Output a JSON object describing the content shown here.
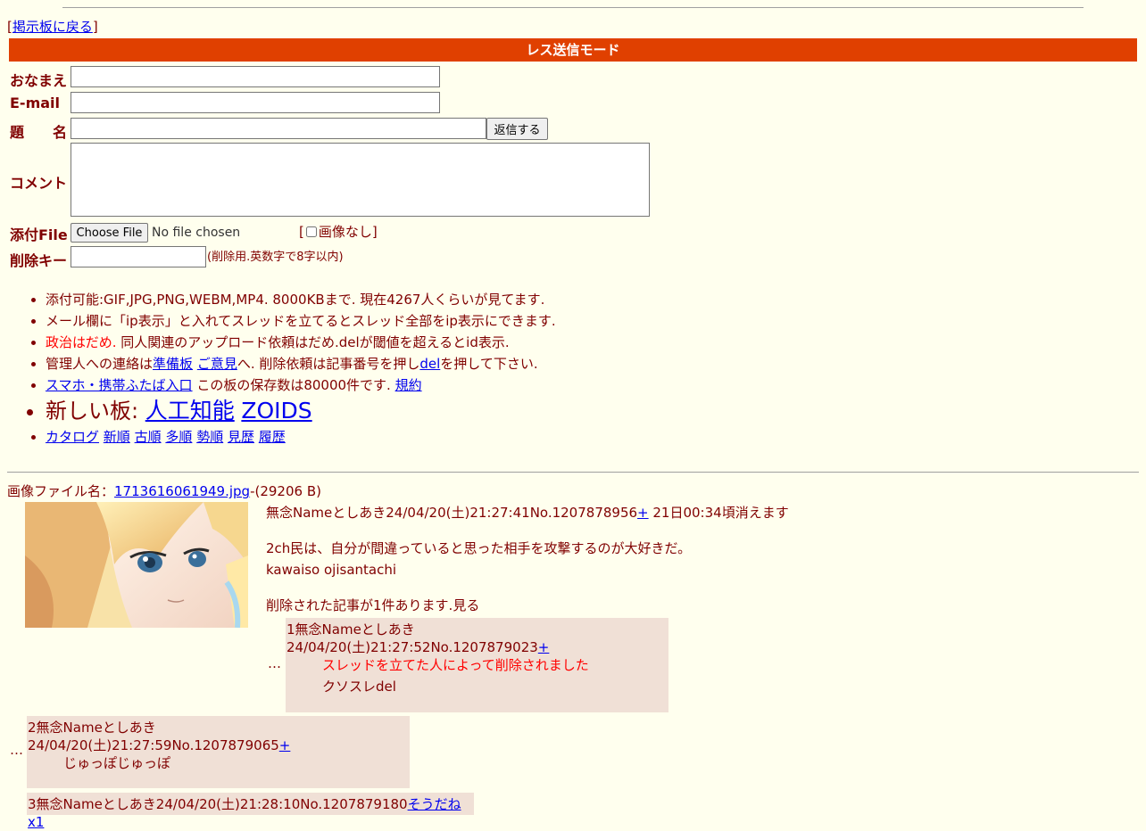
{
  "nav": {
    "open_bracket": "[",
    "back_link": "掲示板に戻る",
    "close_bracket": "]"
  },
  "form": {
    "mode_title": "レス送信モード",
    "name_label": "おなまえ",
    "email_label": "E-mail",
    "subject_label": "題　　名",
    "submit_label": "返信する",
    "comment_label": "コメント",
    "file_label": "添付File",
    "choose_file_label": "Choose File",
    "no_file_text": "No file chosen",
    "no_image_open": "[",
    "no_image_label": "画像なし]",
    "delkey_label": "削除キー",
    "delkey_hint": "(削除用.英数字で8字以内)"
  },
  "notes": {
    "line1": "添付可能:GIF,JPG,PNG,WEBM,MP4. 8000KBまで. 現在4267人くらいが見てます.",
    "line2": "メール欄に「ip表示」と入れてスレッドを立てるとスレッド全部をip表示にできます.",
    "line3_red": "政治はだめ.",
    "line3_rest": " 同人関連のアップロード依頼はだめ.delが閾値を超えるとid表示.",
    "line4_pre": "管理人への連絡は",
    "line4_link1": "準備板",
    "line4_link2": "ご意見",
    "line4_mid": "へ. 削除依頼は記事番号を押し",
    "line4_link3": "del",
    "line4_post": "を押して下さい.",
    "line5_link": "スマホ・携帯ふたば入口",
    "line5_mid": " この板の保存数は80000件です. ",
    "line5_link2": "規約",
    "line6_pre": "新しい板: ",
    "line6_link1": "人工知能",
    "line6_link2": "ZOIDS",
    "sort_links": [
      "カタログ",
      "新順",
      "古順",
      "多順",
      "勢順",
      "見歴",
      "履歴"
    ]
  },
  "thread": {
    "file_label": "画像ファイル名：",
    "file_name": "1713616061949.jpg",
    "file_size": "-(29206 B)",
    "op_header": "無念Nameとしあき24/04/20(土)21:27:41No.1207878956",
    "op_plus": "+",
    "op_expire": " 21日00:34頃消えます",
    "op_body1": "2ch民は、自分が間違っていると思った相手を攻撃するのが大好きだ。",
    "op_body2": "kawaiso ojisantachi",
    "deleted_note": "削除された記事が1件あります.見る",
    "dots": "…",
    "replies": [
      {
        "header": "1無念Nameとしあき24/04/20(土)21:27:52No.1207879023",
        "plus": "+",
        "body_red": "スレッドを立てた人によって削除されました",
        "body": "クソスレdel"
      },
      {
        "header": "2無念Nameとしあき24/04/20(土)21:27:59No.1207879065",
        "plus": "+",
        "body": "じゅっぽじゅっぽ"
      },
      {
        "header": "3無念Nameとしあき24/04/20(土)21:28:10No.1207879180",
        "sodane": "そうだねx1"
      }
    ]
  }
}
